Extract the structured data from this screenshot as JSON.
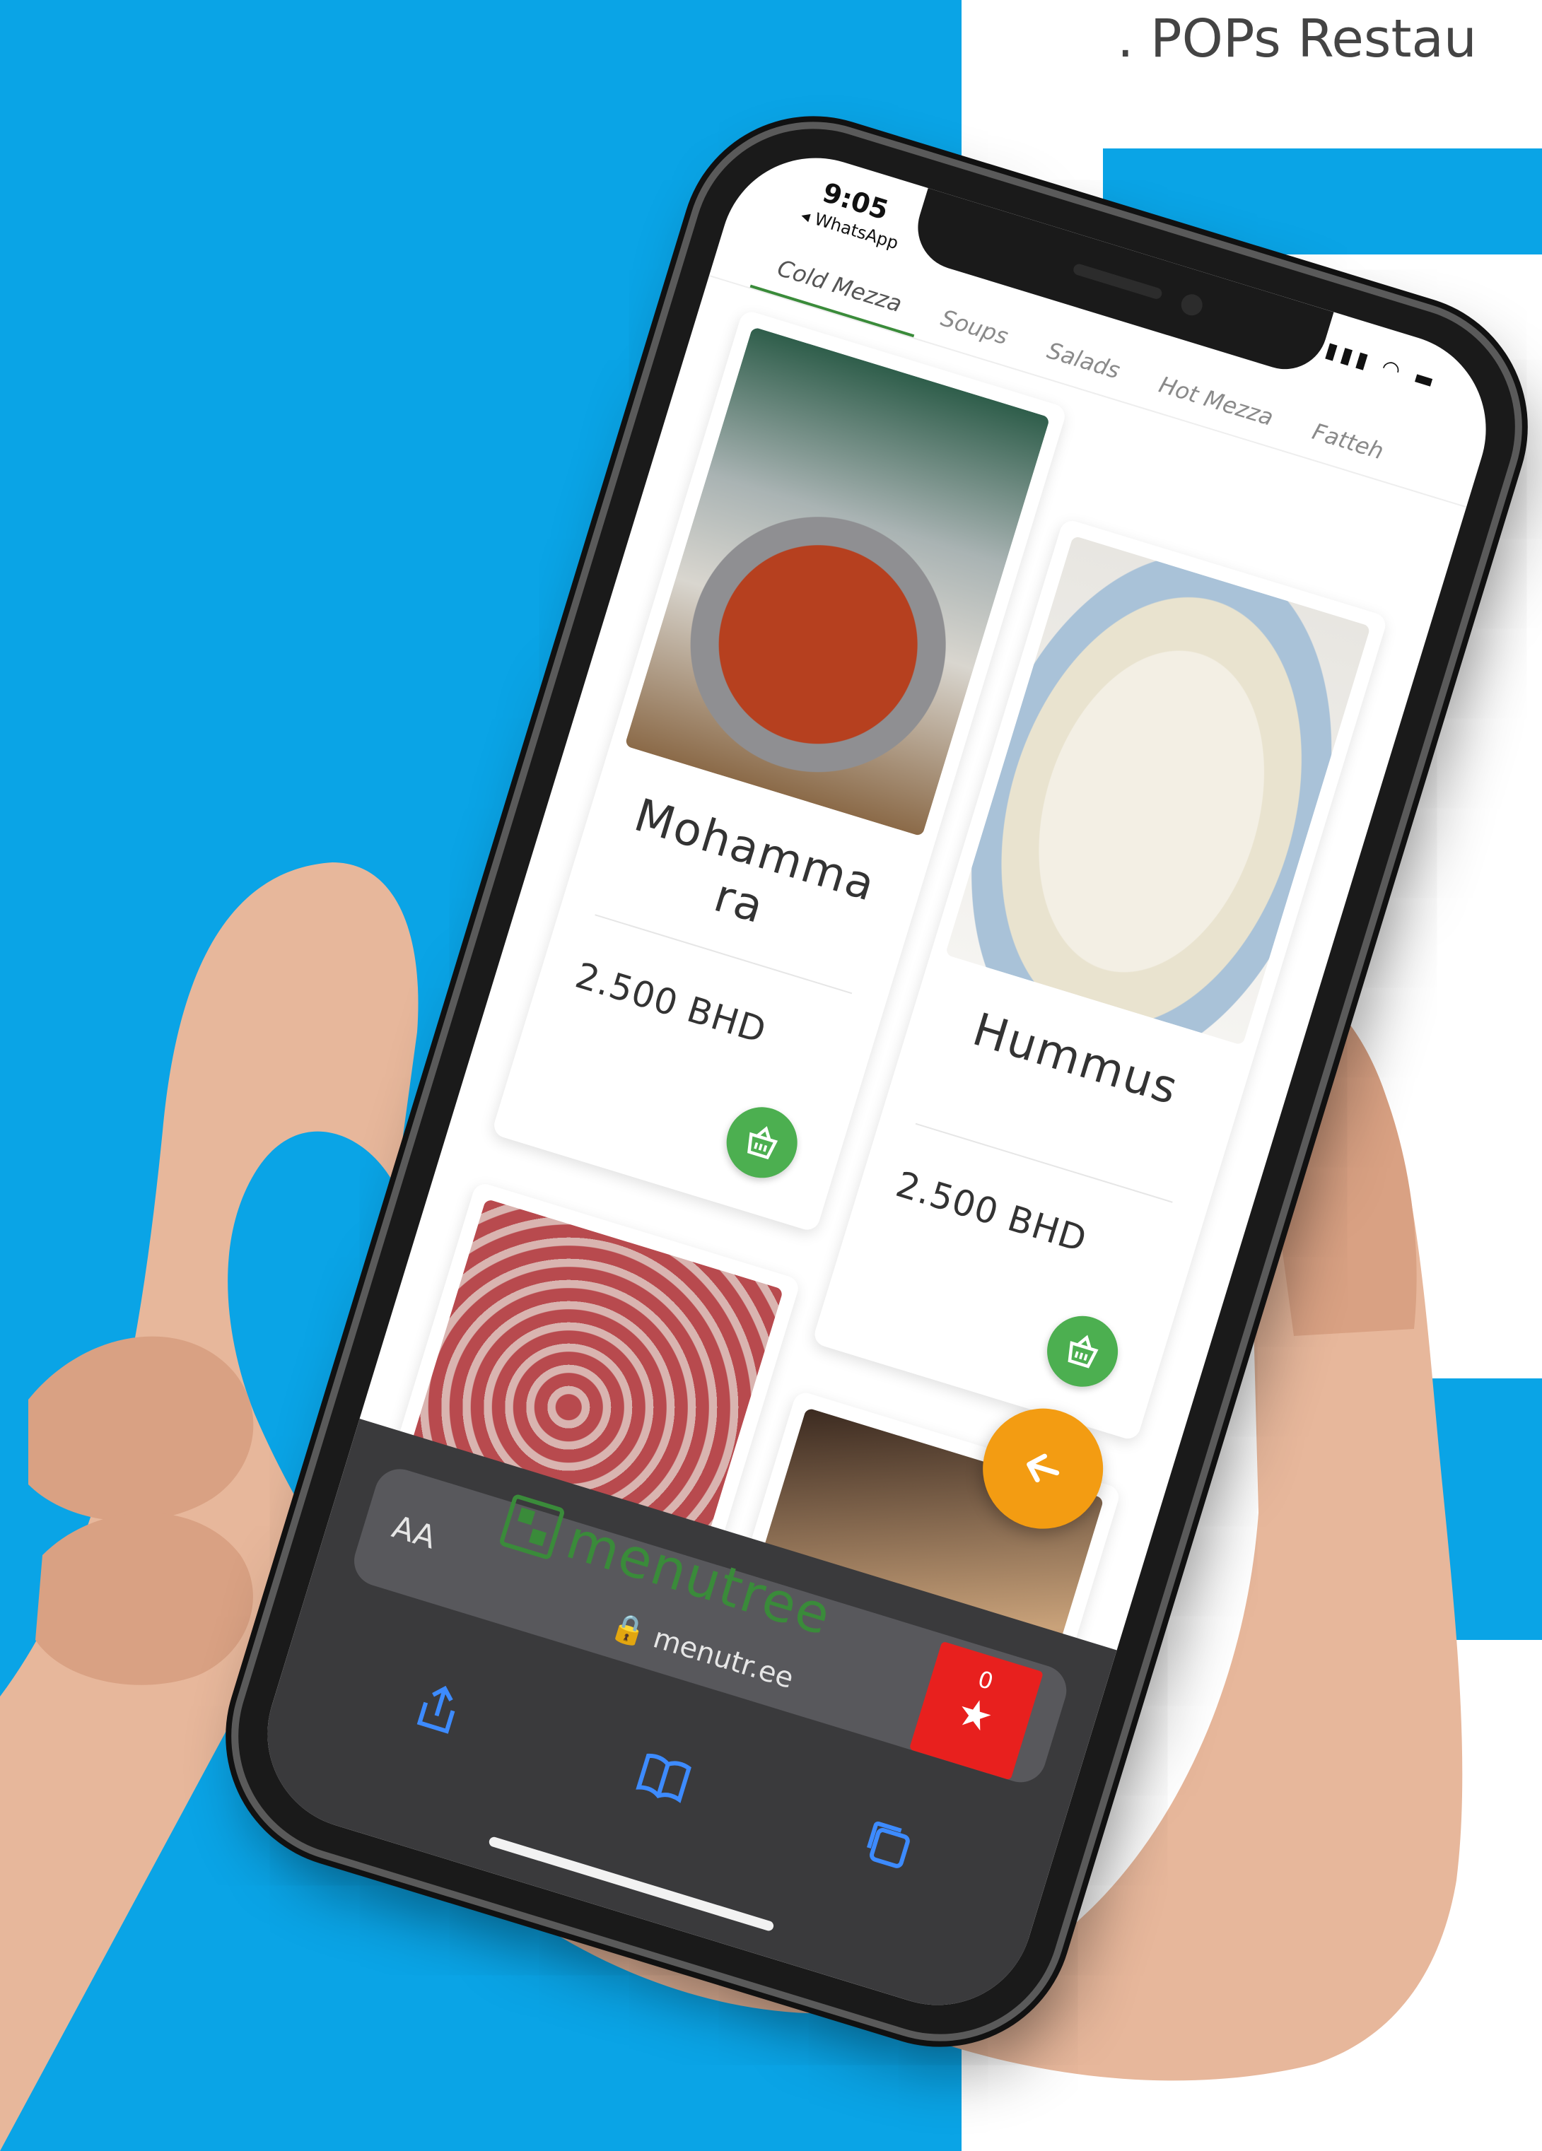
{
  "page": {
    "header_text": ". POPs Restau"
  },
  "status_bar": {
    "time": "9:05",
    "back_app": "◂ WhatsApp",
    "signal_icons": "▮▮▮ ◠ ▬"
  },
  "tabs": [
    {
      "label": "Cold Mezza",
      "active": true
    },
    {
      "label": "Soups",
      "active": false
    },
    {
      "label": "Salads",
      "active": false
    },
    {
      "label": "Hot Mezza",
      "active": false
    },
    {
      "label": "Fatteh",
      "active": false
    }
  ],
  "menu_items": [
    {
      "name": "Mohamma ra",
      "price": "2.500 BHD",
      "cart_icon": "basket-icon"
    },
    {
      "name": "Hummus",
      "price": "2.500 BHD",
      "cart_icon": "basket-icon"
    }
  ],
  "footer": {
    "brand": "menutree",
    "favorites_count": "0",
    "favorites_icon": "★"
  },
  "browser": {
    "aa_label": "AA",
    "url": "🔒 menutr.ee",
    "reload_icon": "↻"
  },
  "colors": {
    "background_blue": "#0aa4e6",
    "brand_green": "#3a8b3a",
    "cart_green": "#4caf50",
    "fab_orange": "#f39c12",
    "badge_red": "#e8201e"
  }
}
